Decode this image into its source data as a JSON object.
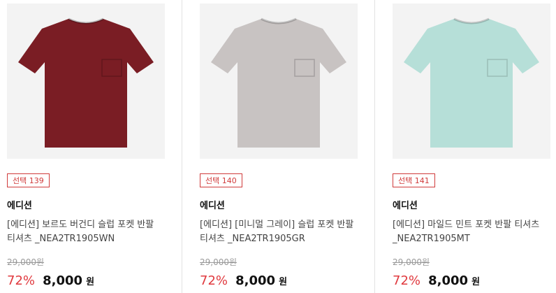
{
  "products": [
    {
      "badge": "선택 139",
      "brand": "에디션",
      "name": "[에디션] 보르도 버건디 슬럽 포켓 반팔 티셔츠 _NEA2TR1905WN",
      "original_price": "29,000원",
      "discount": "72%",
      "price": "8,000",
      "price_unit": "원",
      "shirt_color": "#7a1d24",
      "image_icon": "tshirt-icon"
    },
    {
      "badge": "선택 140",
      "brand": "에디션",
      "name": "[에디션] [미니멀 그레이] 슬럽 포켓 반팔 티셔츠 _NEA2TR1905GR",
      "original_price": "29,000원",
      "discount": "72%",
      "price": "8,000",
      "price_unit": "원",
      "shirt_color": "#c8c3c2",
      "image_icon": "tshirt-icon"
    },
    {
      "badge": "선택 141",
      "brand": "에디션",
      "name": "[에디션] 마일드 민트 포켓 반팔 티셔츠 _NEA2TR1905MT",
      "original_price": "29,000원",
      "discount": "72%",
      "price": "8,000",
      "price_unit": "원",
      "shirt_color": "#b6dfd8",
      "image_icon": "tshirt-icon"
    }
  ],
  "colors": {
    "accent_red": "#e0393e",
    "badge_red": "#d03b3b",
    "muted": "#999999"
  }
}
